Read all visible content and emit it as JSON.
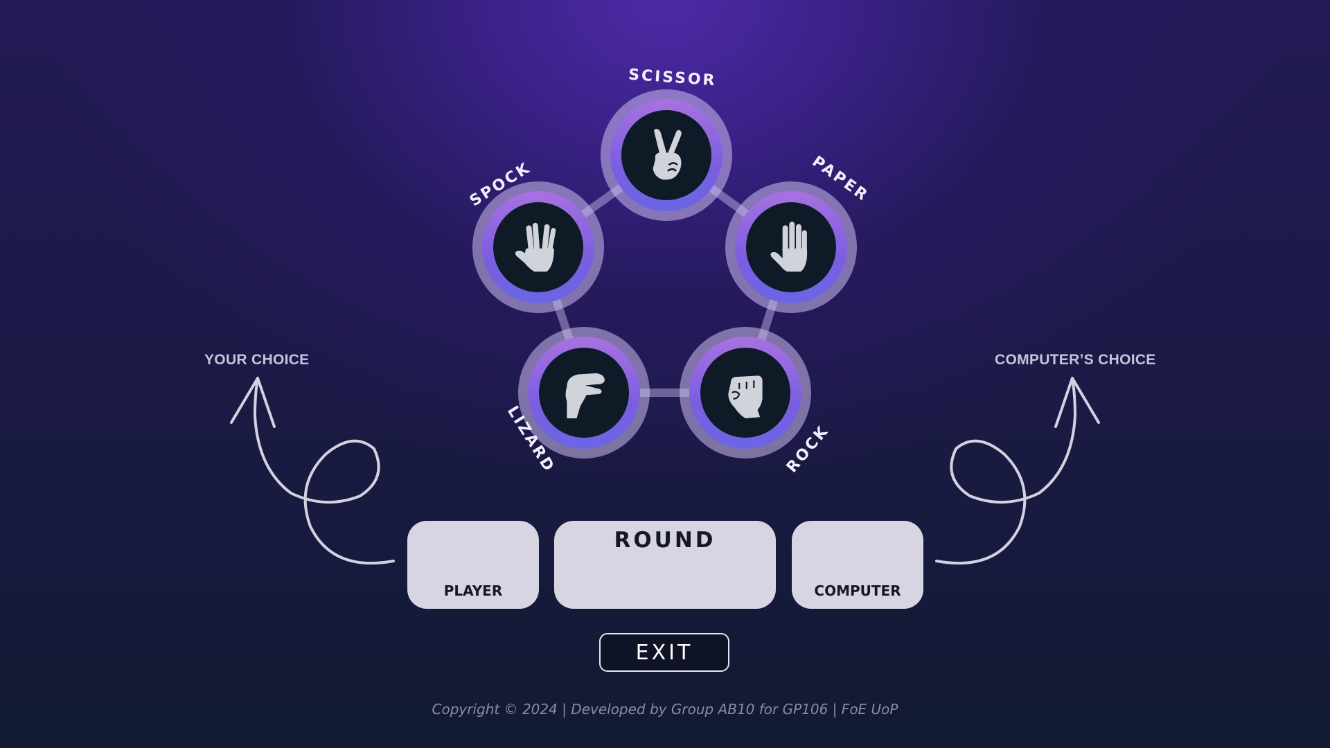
{
  "choices": [
    {
      "id": "scissor",
      "label": "SCISSOR",
      "icon": "scissor-hand-icon"
    },
    {
      "id": "paper",
      "label": "PAPER",
      "icon": "paper-hand-icon"
    },
    {
      "id": "rock",
      "label": "ROCK",
      "icon": "rock-fist-icon"
    },
    {
      "id": "lizard",
      "label": "LIZARD",
      "icon": "lizard-hand-icon"
    },
    {
      "id": "spock",
      "label": "SPOCK",
      "icon": "spock-hand-icon"
    }
  ],
  "labels": {
    "your_choice": "YOUR CHOICE",
    "computer_choice": "COMPUTER’S CHOICE"
  },
  "panels": {
    "player": "PLAYER",
    "round": "ROUND",
    "computer": "COMPUTER"
  },
  "exit_label": "EXIT",
  "footer": "Copyright © 2024 | Developed by Group AB10 for GP106 | FoE UoP",
  "colors": {
    "ring_top": "#a772e0",
    "ring_bottom": "#6a66e4",
    "core": "#0f1a27",
    "panel": "#d6d5e1",
    "hand": "#d0d4da"
  }
}
